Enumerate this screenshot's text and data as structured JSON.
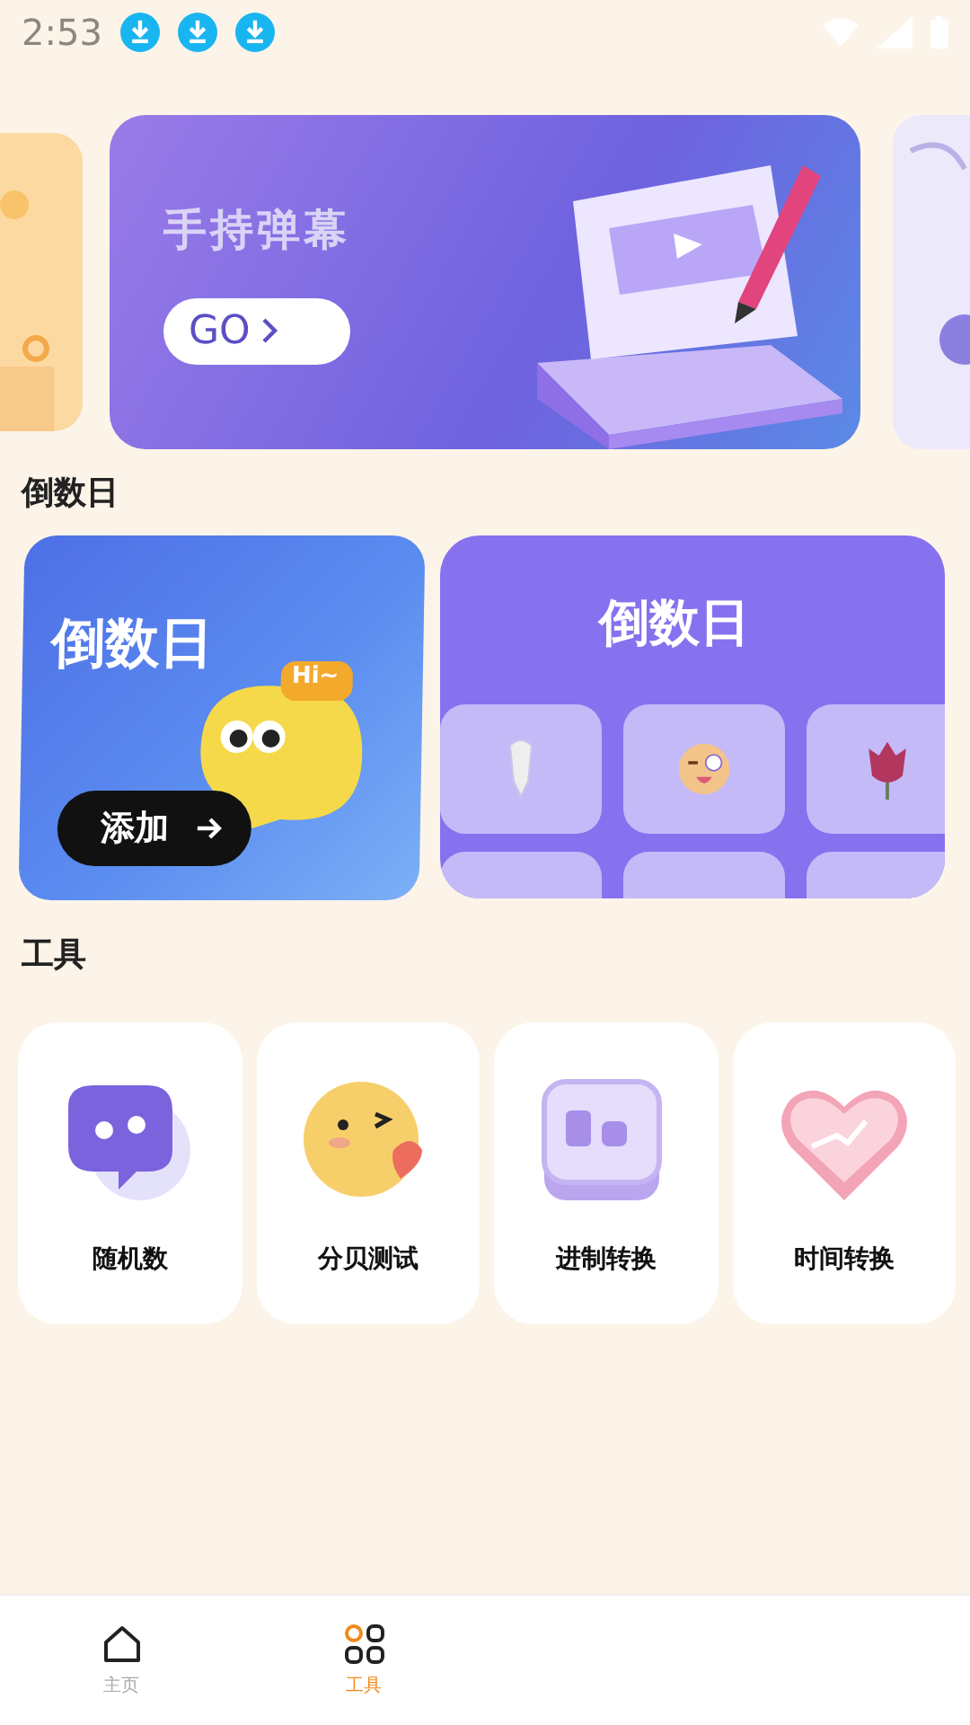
{
  "status_bar": {
    "time": "2:53",
    "notifications": [
      {
        "kind": "download"
      },
      {
        "kind": "download"
      },
      {
        "kind": "download"
      }
    ]
  },
  "banner": {
    "title": "手持弹幕",
    "button": "GO"
  },
  "countdown": {
    "title": "倒数日",
    "add_card": {
      "title": "倒数日",
      "bubble": "Hi~",
      "button": "添加"
    },
    "gallery_card": {
      "title": "倒数日"
    }
  },
  "tools": {
    "title": "工具",
    "items": [
      {
        "label": "随机数",
        "kind": "chat"
      },
      {
        "label": "分贝测试",
        "kind": "emoji"
      },
      {
        "label": "进制转换",
        "kind": "text"
      },
      {
        "label": "时间转换",
        "kind": "heart"
      }
    ]
  },
  "bottom_nav": [
    {
      "label": "主页",
      "kind": "home",
      "selected": false
    },
    {
      "label": "工具",
      "kind": "grid",
      "selected": true
    }
  ]
}
